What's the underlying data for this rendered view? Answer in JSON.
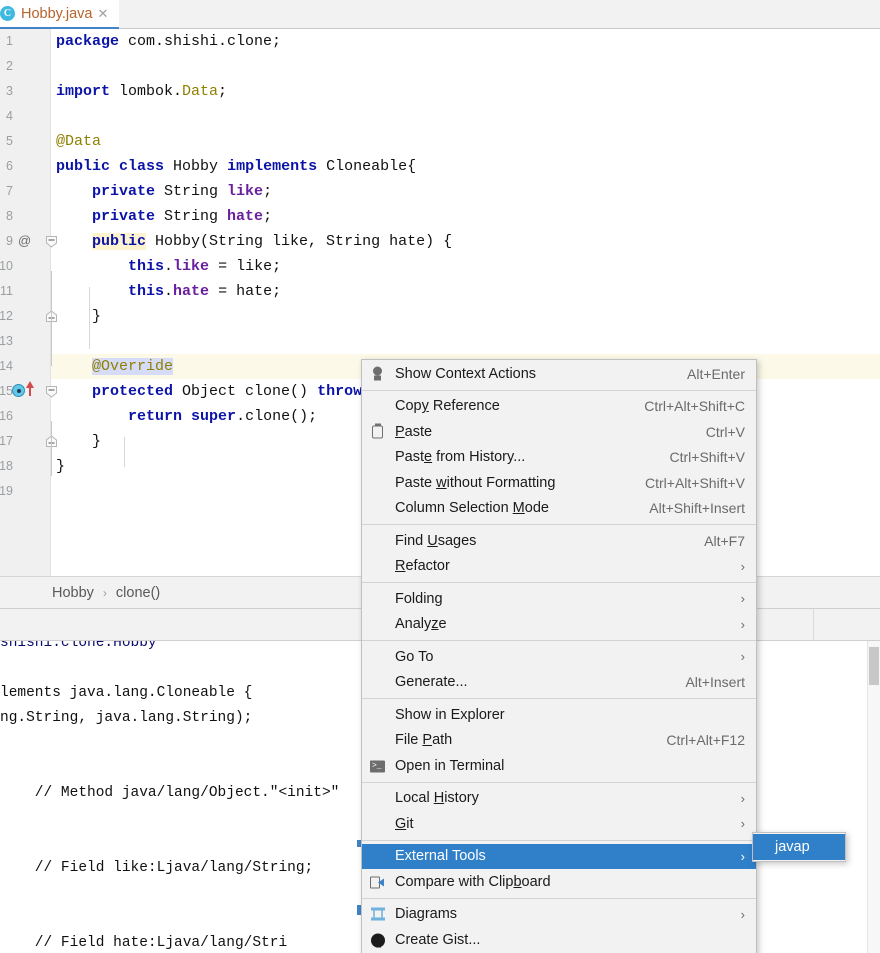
{
  "window": {
    "app": "IntelliJ IDEA",
    "accent_color": "#2f7fc9",
    "tab_underline_color": "#4383c9"
  },
  "tabstrip": {
    "tabs": [
      {
        "label": "Hobby.java",
        "icon": "java-class-icon",
        "icon_letter": "C",
        "close_icon": "✕",
        "active": true
      }
    ]
  },
  "editor": {
    "line_numbers": [
      "1",
      "2",
      "3",
      "4",
      "5",
      "6",
      "7",
      "8",
      "9",
      "10",
      "11",
      "12",
      "13",
      "14",
      "15",
      "16",
      "17",
      "18",
      "19"
    ],
    "gutter_annotation_marker": "@",
    "code_lines": [
      {
        "n": 1,
        "indent": 0,
        "segments": [
          {
            "t": "package",
            "c": "kw"
          },
          {
            "t": " com.shishi.clone;",
            "c": ""
          }
        ]
      },
      {
        "n": 2,
        "indent": 0,
        "segments": []
      },
      {
        "n": 3,
        "indent": 0,
        "segments": [
          {
            "t": "import",
            "c": "kw"
          },
          {
            "t": " lombok.",
            "c": ""
          },
          {
            "t": "Data",
            "c": "anno"
          },
          {
            "t": ";",
            "c": ""
          }
        ]
      },
      {
        "n": 4,
        "indent": 0,
        "segments": []
      },
      {
        "n": 5,
        "indent": 0,
        "segments": [
          {
            "t": "@Data",
            "c": "anno"
          }
        ]
      },
      {
        "n": 6,
        "indent": 0,
        "segments": [
          {
            "t": "public",
            "c": "kw"
          },
          {
            "t": " ",
            "c": ""
          },
          {
            "t": "class",
            "c": "kw"
          },
          {
            "t": " Hobby ",
            "c": ""
          },
          {
            "t": "implements",
            "c": "kw"
          },
          {
            "t": " Cloneable{",
            "c": ""
          }
        ]
      },
      {
        "n": 7,
        "indent": 1,
        "segments": [
          {
            "t": "private",
            "c": "kw"
          },
          {
            "t": " String ",
            "c": ""
          },
          {
            "t": "like",
            "c": "fld"
          },
          {
            "t": ";",
            "c": ""
          }
        ]
      },
      {
        "n": 8,
        "indent": 1,
        "segments": [
          {
            "t": "private",
            "c": "kw"
          },
          {
            "t": " String ",
            "c": ""
          },
          {
            "t": "hate",
            "c": "fld"
          },
          {
            "t": ";",
            "c": ""
          }
        ]
      },
      {
        "n": 9,
        "indent": 1,
        "segments": [
          {
            "t": "public",
            "c": "kw anno-hl"
          },
          {
            "t": " Hobby(String like, String hate) {",
            "c": ""
          }
        ]
      },
      {
        "n": 10,
        "indent": 2,
        "segments": [
          {
            "t": "this",
            "c": "kw"
          },
          {
            "t": ".",
            "c": ""
          },
          {
            "t": "like",
            "c": "fld"
          },
          {
            "t": " = like;",
            "c": ""
          }
        ]
      },
      {
        "n": 11,
        "indent": 2,
        "segments": [
          {
            "t": "this",
            "c": "kw"
          },
          {
            "t": ".",
            "c": ""
          },
          {
            "t": "hate",
            "c": "fld"
          },
          {
            "t": " = hate;",
            "c": ""
          }
        ]
      },
      {
        "n": 12,
        "indent": 1,
        "segments": [
          {
            "t": "}",
            "c": ""
          }
        ]
      },
      {
        "n": 13,
        "indent": 0,
        "segments": []
      },
      {
        "n": 14,
        "indent": 1,
        "segments": [
          {
            "t": "@Override",
            "c": "anno sel"
          }
        ]
      },
      {
        "n": 15,
        "indent": 1,
        "segments": [
          {
            "t": "protected",
            "c": "kw"
          },
          {
            "t": " Object clone() ",
            "c": ""
          },
          {
            "t": "throw",
            "c": "kw"
          }
        ]
      },
      {
        "n": 16,
        "indent": 2,
        "segments": [
          {
            "t": "return",
            "c": "kw"
          },
          {
            "t": " ",
            "c": ""
          },
          {
            "t": "super",
            "c": "kw"
          },
          {
            "t": ".clone();",
            "c": ""
          }
        ]
      },
      {
        "n": 17,
        "indent": 1,
        "segments": [
          {
            "t": "}",
            "c": ""
          }
        ]
      },
      {
        "n": 18,
        "indent": 0,
        "segments": [
          {
            "t": "}",
            "c": ""
          }
        ]
      },
      {
        "n": 19,
        "indent": 0,
        "segments": []
      }
    ],
    "highlighted_line": 14,
    "caret_line": 14,
    "override_marker_line": 15
  },
  "breadcrumb": {
    "items": [
      "Hobby",
      "clone()"
    ],
    "separator": "›"
  },
  "console": {
    "lines": [
      "shishi.clone.Hobby",
      "",
      "lements java.lang.Cloneable {",
      "ng.String, java.lang.String);",
      "",
      "",
      "    // Method java/lang/Object.\"<init>\"",
      "",
      "",
      "    // Field like:Ljava/lang/String;",
      "",
      "",
      "    // Field hate:Ljava/lang/Stri"
    ]
  },
  "context_menu": {
    "groups": [
      [
        {
          "label": "Show Context Actions",
          "accel": "Alt+Enter",
          "icon": "lightbulb-icon",
          "submenu": false,
          "mnemonic": ""
        }
      ],
      [
        {
          "label": "Copy Reference",
          "accel": "Ctrl+Alt+Shift+C",
          "icon": "",
          "submenu": false,
          "mnemonic": "y"
        },
        {
          "label": "Paste",
          "accel": "Ctrl+V",
          "icon": "clipboard-icon",
          "submenu": false,
          "mnemonic": "P"
        },
        {
          "label": "Paste from History...",
          "accel": "Ctrl+Shift+V",
          "icon": "",
          "submenu": false,
          "mnemonic": "e"
        },
        {
          "label": "Paste without Formatting",
          "accel": "Ctrl+Alt+Shift+V",
          "icon": "",
          "submenu": false,
          "mnemonic": "w"
        },
        {
          "label": "Column Selection Mode",
          "accel": "Alt+Shift+Insert",
          "icon": "",
          "submenu": false,
          "mnemonic": "M"
        }
      ],
      [
        {
          "label": "Find Usages",
          "accel": "Alt+F7",
          "icon": "",
          "submenu": false,
          "mnemonic": "U"
        },
        {
          "label": "Refactor",
          "accel": "",
          "icon": "",
          "submenu": true,
          "mnemonic": "R"
        }
      ],
      [
        {
          "label": "Folding",
          "accel": "",
          "icon": "",
          "submenu": true,
          "mnemonic": ""
        },
        {
          "label": "Analyze",
          "accel": "",
          "icon": "",
          "submenu": true,
          "mnemonic": "z"
        }
      ],
      [
        {
          "label": "Go To",
          "accel": "",
          "icon": "",
          "submenu": true,
          "mnemonic": ""
        },
        {
          "label": "Generate...",
          "accel": "Alt+Insert",
          "icon": "",
          "submenu": false,
          "mnemonic": ""
        }
      ],
      [
        {
          "label": "Show in Explorer",
          "accel": "",
          "icon": "",
          "submenu": false,
          "mnemonic": ""
        },
        {
          "label": "File Path",
          "accel": "Ctrl+Alt+F12",
          "icon": "",
          "submenu": false,
          "mnemonic": "P"
        },
        {
          "label": "Open in Terminal",
          "accel": "",
          "icon": "terminal-icon",
          "submenu": false,
          "mnemonic": ""
        }
      ],
      [
        {
          "label": "Local History",
          "accel": "",
          "icon": "",
          "submenu": true,
          "mnemonic": "H"
        },
        {
          "label": "Git",
          "accel": "",
          "icon": "",
          "submenu": true,
          "mnemonic": "G"
        }
      ],
      [
        {
          "label": "External Tools",
          "accel": "",
          "icon": "",
          "submenu": true,
          "mnemonic": "",
          "selected": true
        },
        {
          "label": "Compare with Clipboard",
          "accel": "",
          "icon": "compare-clipboard-icon",
          "submenu": false,
          "mnemonic": "b"
        }
      ],
      [
        {
          "label": "Diagrams",
          "accel": "",
          "icon": "diagrams-icon",
          "submenu": true,
          "mnemonic": ""
        },
        {
          "label": "Create Gist...",
          "accel": "",
          "icon": "github-icon",
          "submenu": false,
          "mnemonic": ""
        }
      ]
    ],
    "submenu_arrow": "›"
  },
  "submenu": {
    "title": "External Tools",
    "items": [
      {
        "label": "javap",
        "selected": true
      }
    ]
  }
}
